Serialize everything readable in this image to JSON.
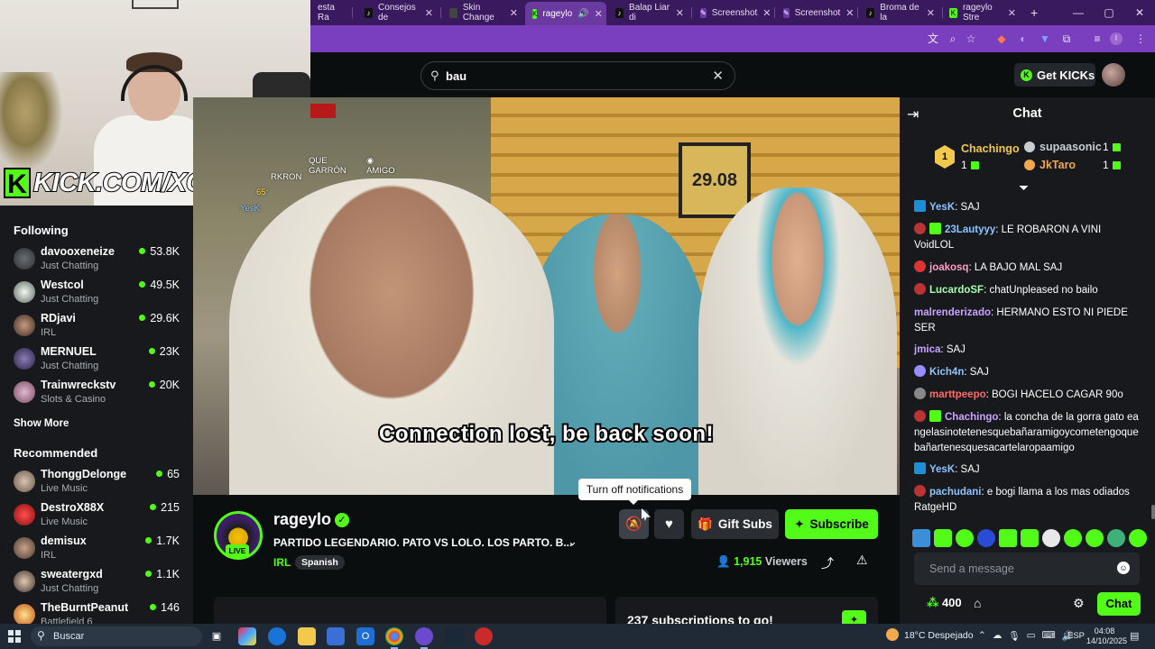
{
  "browser": {
    "tabs": [
      {
        "label": "esta Ra",
        "icon": "tab-icon"
      },
      {
        "label": "Consejos de",
        "icon": "tiktok-icon"
      },
      {
        "label": "Skin Change",
        "icon": "page-icon"
      },
      {
        "label": "rageylo",
        "icon": "kick-icon",
        "active": true
      },
      {
        "label": "Balap Liar di",
        "icon": "tiktok-icon"
      },
      {
        "label": "Screenshot",
        "icon": "screenshot-icon"
      },
      {
        "label": "Screenshot",
        "icon": "screenshot-icon"
      },
      {
        "label": "Broma de la",
        "icon": "tiktok-icon"
      },
      {
        "label": "rageylo Stre",
        "icon": "kick-icon"
      }
    ],
    "new_tab": "+",
    "window_controls": {
      "minimize": "—",
      "maximize": "▢",
      "close": "✕"
    },
    "accent": "#7a3fbf"
  },
  "header": {
    "search_value": "bau",
    "get_kicks_label": "Get KICKs"
  },
  "overlay": {
    "brand_text": "KICK.COM/XOWNZ",
    "brand_letter": "K"
  },
  "sidebar": {
    "following_heading": "Following",
    "following": [
      {
        "name": "davooxeneize",
        "category": "Just Chatting",
        "viewers": "53.8K"
      },
      {
        "name": "Westcol",
        "category": "Just Chatting",
        "viewers": "49.5K"
      },
      {
        "name": "RDjavi",
        "category": "IRL",
        "viewers": "29.6K"
      },
      {
        "name": "MERNUEL",
        "category": "Just Chatting",
        "viewers": "23K"
      },
      {
        "name": "Trainwreckstv",
        "category": "Slots & Casino",
        "viewers": "20K"
      }
    ],
    "show_more_label": "Show More",
    "recommended_heading": "Recommended",
    "recommended": [
      {
        "name": "ThonggDelonge",
        "category": "Live Music",
        "viewers": "65"
      },
      {
        "name": "DestroX88X",
        "category": "Live Music",
        "viewers": "215"
      },
      {
        "name": "demisux",
        "category": "IRL",
        "viewers": "1.7K"
      },
      {
        "name": "sweatergxd",
        "category": "Just Chatting",
        "viewers": "1.1K"
      },
      {
        "name": "TheBurntPeanut",
        "category": "Battlefield 6",
        "viewers": "146"
      }
    ]
  },
  "video": {
    "status_text": "Connection lost, be back soon!",
    "overlay_lines": [
      "QUE GARRÓN",
      "AMIGO",
      "RKRON",
      "65:",
      "YesK:"
    ],
    "sign_text": "29.08"
  },
  "stream": {
    "channel_name": "rageylo",
    "live_label": "LIVE",
    "title": "PARTIDO LEGENDARIO. PATO VS LOLO. LOS PARTO. B...",
    "category": "IRL",
    "language": "Spanish",
    "tooltip": "Turn off notifications",
    "gift_subs_label": "Gift Subs",
    "subscribe_label": "Subscribe",
    "viewer_count": "1,915",
    "viewers_label": "Viewers",
    "subs_goal_text": "237 subscriptions to go!",
    "brand_color": "#53fc18"
  },
  "chat": {
    "title": "Chat",
    "leaderboard": [
      {
        "rank": "1",
        "name": "Chachingo",
        "value": "1",
        "color": "#f2c94c"
      },
      {
        "name": "supaasonic",
        "value": "1",
        "color": "#c9cdd1"
      },
      {
        "name": "JkTaro",
        "value": "1",
        "color": "#f2a94c"
      }
    ],
    "messages": [
      {
        "user": "YesK",
        "sep": ": ",
        "text": "SAJ",
        "color": "#8ec5ff",
        "badge": "#1c8fd6"
      },
      {
        "user": "23Lautyyy",
        "sep": ": ",
        "text": "LE ROBARON A VINI VoidLOL",
        "color": "#8ec5ff",
        "badge": "#b33"
      },
      {
        "user": "joakosq",
        "sep": ": ",
        "text": "LA BAJO MAL SAJ",
        "color": "#ff9ec7",
        "badge": "#d33"
      },
      {
        "user": "LucardoSF",
        "sep": ": ",
        "text": "chatUnpleased no bailo",
        "color": "#a8ffb0",
        "badge": "#b33"
      },
      {
        "user": "malrenderizado",
        "sep": ": ",
        "text": "HERMANO ESTO NI PIEDE SER",
        "color": "#c9a4ff",
        "badge": ""
      },
      {
        "user": "jmica",
        "sep": ": ",
        "text": "SAJ",
        "color": "#c9a4ff",
        "badge": ""
      },
      {
        "user": "Kich4n",
        "sep": ": ",
        "text": "SAJ",
        "color": "#8ec5ff",
        "badge": "#9a8cff"
      },
      {
        "user": "marttpeepo",
        "sep": ": ",
        "text": "BOGI HACELO CAGAR 90o",
        "color": "#ff6b6b",
        "badge": "#888"
      },
      {
        "user": "Chachingo",
        "sep": ": ",
        "text": "la concha de la gorra gato eangelasinotetenesquebañaramigoycometengoquebañartenesquesacartelaropaamigo",
        "color": "#c9a4ff",
        "badge": "#b33"
      },
      {
        "user": "YesK",
        "sep": ": ",
        "text": "SAJ",
        "color": "#8ec5ff",
        "badge": "#1c8fd6"
      },
      {
        "user": "pachudani",
        "sep": ": ",
        "text": "e bogi llama a los mas odiados RatgeHD",
        "color": "#8ec5ff",
        "badge": "#b33"
      }
    ],
    "input_placeholder": "Send a message",
    "kick_points": "400",
    "send_label": "Chat"
  },
  "taskbar": {
    "search_label": "Buscar",
    "weather": "18°C  Despejado",
    "language": "ESP",
    "time": "04:08",
    "date": "14/10/2025"
  }
}
